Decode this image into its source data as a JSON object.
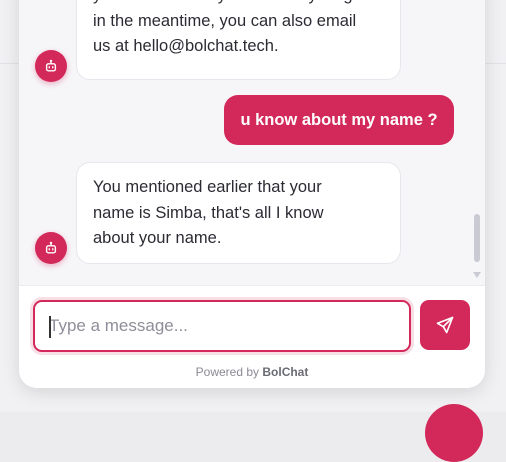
{
  "messages": [
    {
      "sender": "bot",
      "lines": [
        "your business. If you need anything",
        "in the meantime, you can also email",
        "us at hello@bolchat.tech."
      ]
    },
    {
      "sender": "user",
      "text": "u know about my name ?"
    },
    {
      "sender": "bot",
      "lines": [
        "You mentioned earlier that your",
        "name is Simba, that's all I know",
        "about your name."
      ]
    }
  ],
  "composer": {
    "placeholder": "Type a message...",
    "value": ""
  },
  "footer": {
    "powered_prefix": "Powered by",
    "brand": "BolChat"
  },
  "icons": {
    "avatar": "robot-icon",
    "send": "send-icon"
  },
  "colors": {
    "accent": "#d3285a",
    "bubble_bg": "#ffffff",
    "chat_bg": "#f6f6f9"
  }
}
